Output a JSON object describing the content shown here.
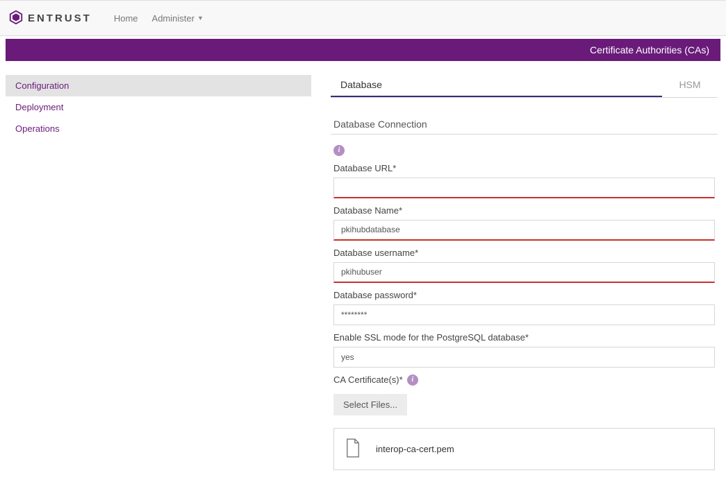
{
  "brand": "ENTRUST",
  "nav": {
    "home": "Home",
    "administer": "Administer"
  },
  "ribbon": {
    "title": "Certificate Authorities (CAs)"
  },
  "sidebar": {
    "items": [
      {
        "label": "Configuration"
      },
      {
        "label": "Deployment"
      },
      {
        "label": "Operations"
      }
    ]
  },
  "tabs": {
    "database": "Database",
    "hsm": "HSM"
  },
  "section": {
    "title": "Database Connection"
  },
  "form": {
    "url": {
      "label": "Database URL*",
      "value": " "
    },
    "name": {
      "label": "Database Name*",
      "value": "pkihubdatabase"
    },
    "user": {
      "label": "Database username*",
      "value": "pkihubuser"
    },
    "pass": {
      "label": "Database password*",
      "value": "********"
    },
    "ssl": {
      "label": "Enable SSL mode for the PostgreSQL database*",
      "value": "yes"
    },
    "cert": {
      "label": "CA Certificate(s)*",
      "button": "Select Files...",
      "filename": "interop-ca-cert.pem"
    }
  }
}
